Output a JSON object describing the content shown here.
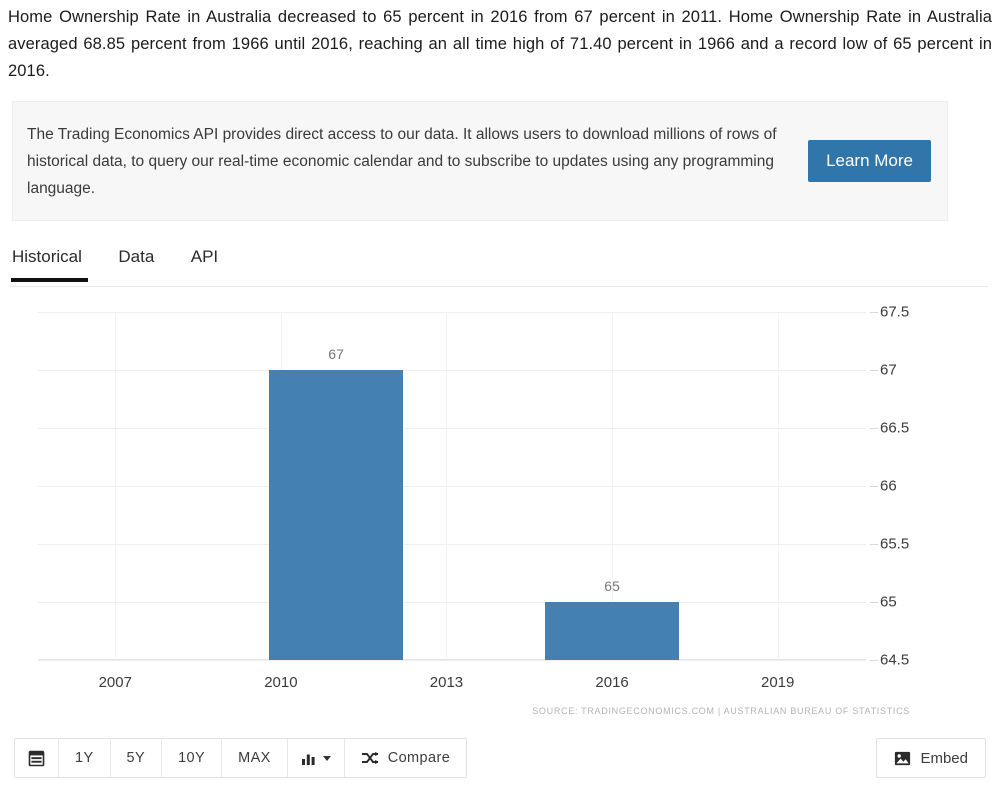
{
  "intro": {
    "text": "Home Ownership Rate in Australia decreased to 65 percent in 2016 from 67 percent in 2011. Home Ownership Rate in Australia averaged 68.85 percent from 1966 until 2016, reaching an all time high of 71.40 percent in 1966 and a record low of 65 percent in 2016."
  },
  "api_banner": {
    "text": "The Trading Economics API provides direct access to our data. It allows users to download millions of rows of historical data, to query our real-time economic calendar and to subscribe to updates using any programming language.",
    "button_label": "Learn More",
    "button_color": "#3176ab"
  },
  "tabs": [
    {
      "label": "Historical",
      "active": true
    },
    {
      "label": "Data",
      "active": false
    },
    {
      "label": "API",
      "active": false
    }
  ],
  "chart_data": {
    "type": "bar",
    "title": "",
    "xlabel": "",
    "ylabel": "",
    "categories": [
      "2011",
      "2016"
    ],
    "values": [
      67,
      65
    ],
    "data_labels": [
      "67",
      "65"
    ],
    "bar_color": "#4580b2",
    "ylim": [
      64.5,
      67.5
    ],
    "yticks": [
      "67.5",
      "67",
      "66.5",
      "66",
      "65.5",
      "65",
      "64.5"
    ],
    "ytick_values": [
      67.5,
      67,
      66.5,
      66,
      65.5,
      65,
      64.5
    ],
    "xticks": [
      "2007",
      "2010",
      "2013",
      "2016",
      "2019"
    ],
    "xtick_values": [
      2007,
      2010,
      2013,
      2016,
      2019
    ],
    "xlim": [
      2005.6,
      2020.6
    ],
    "grid": true,
    "legend": "none",
    "y_axis_position": "right",
    "source": "SOURCE: TRADINGECONOMICS.COM | AUSTRALIAN BUREAU OF STATISTICS"
  },
  "toolbar": {
    "range_buttons": [
      "1Y",
      "5Y",
      "10Y",
      "MAX"
    ],
    "compare_label": "Compare",
    "embed_label": "Embed"
  }
}
